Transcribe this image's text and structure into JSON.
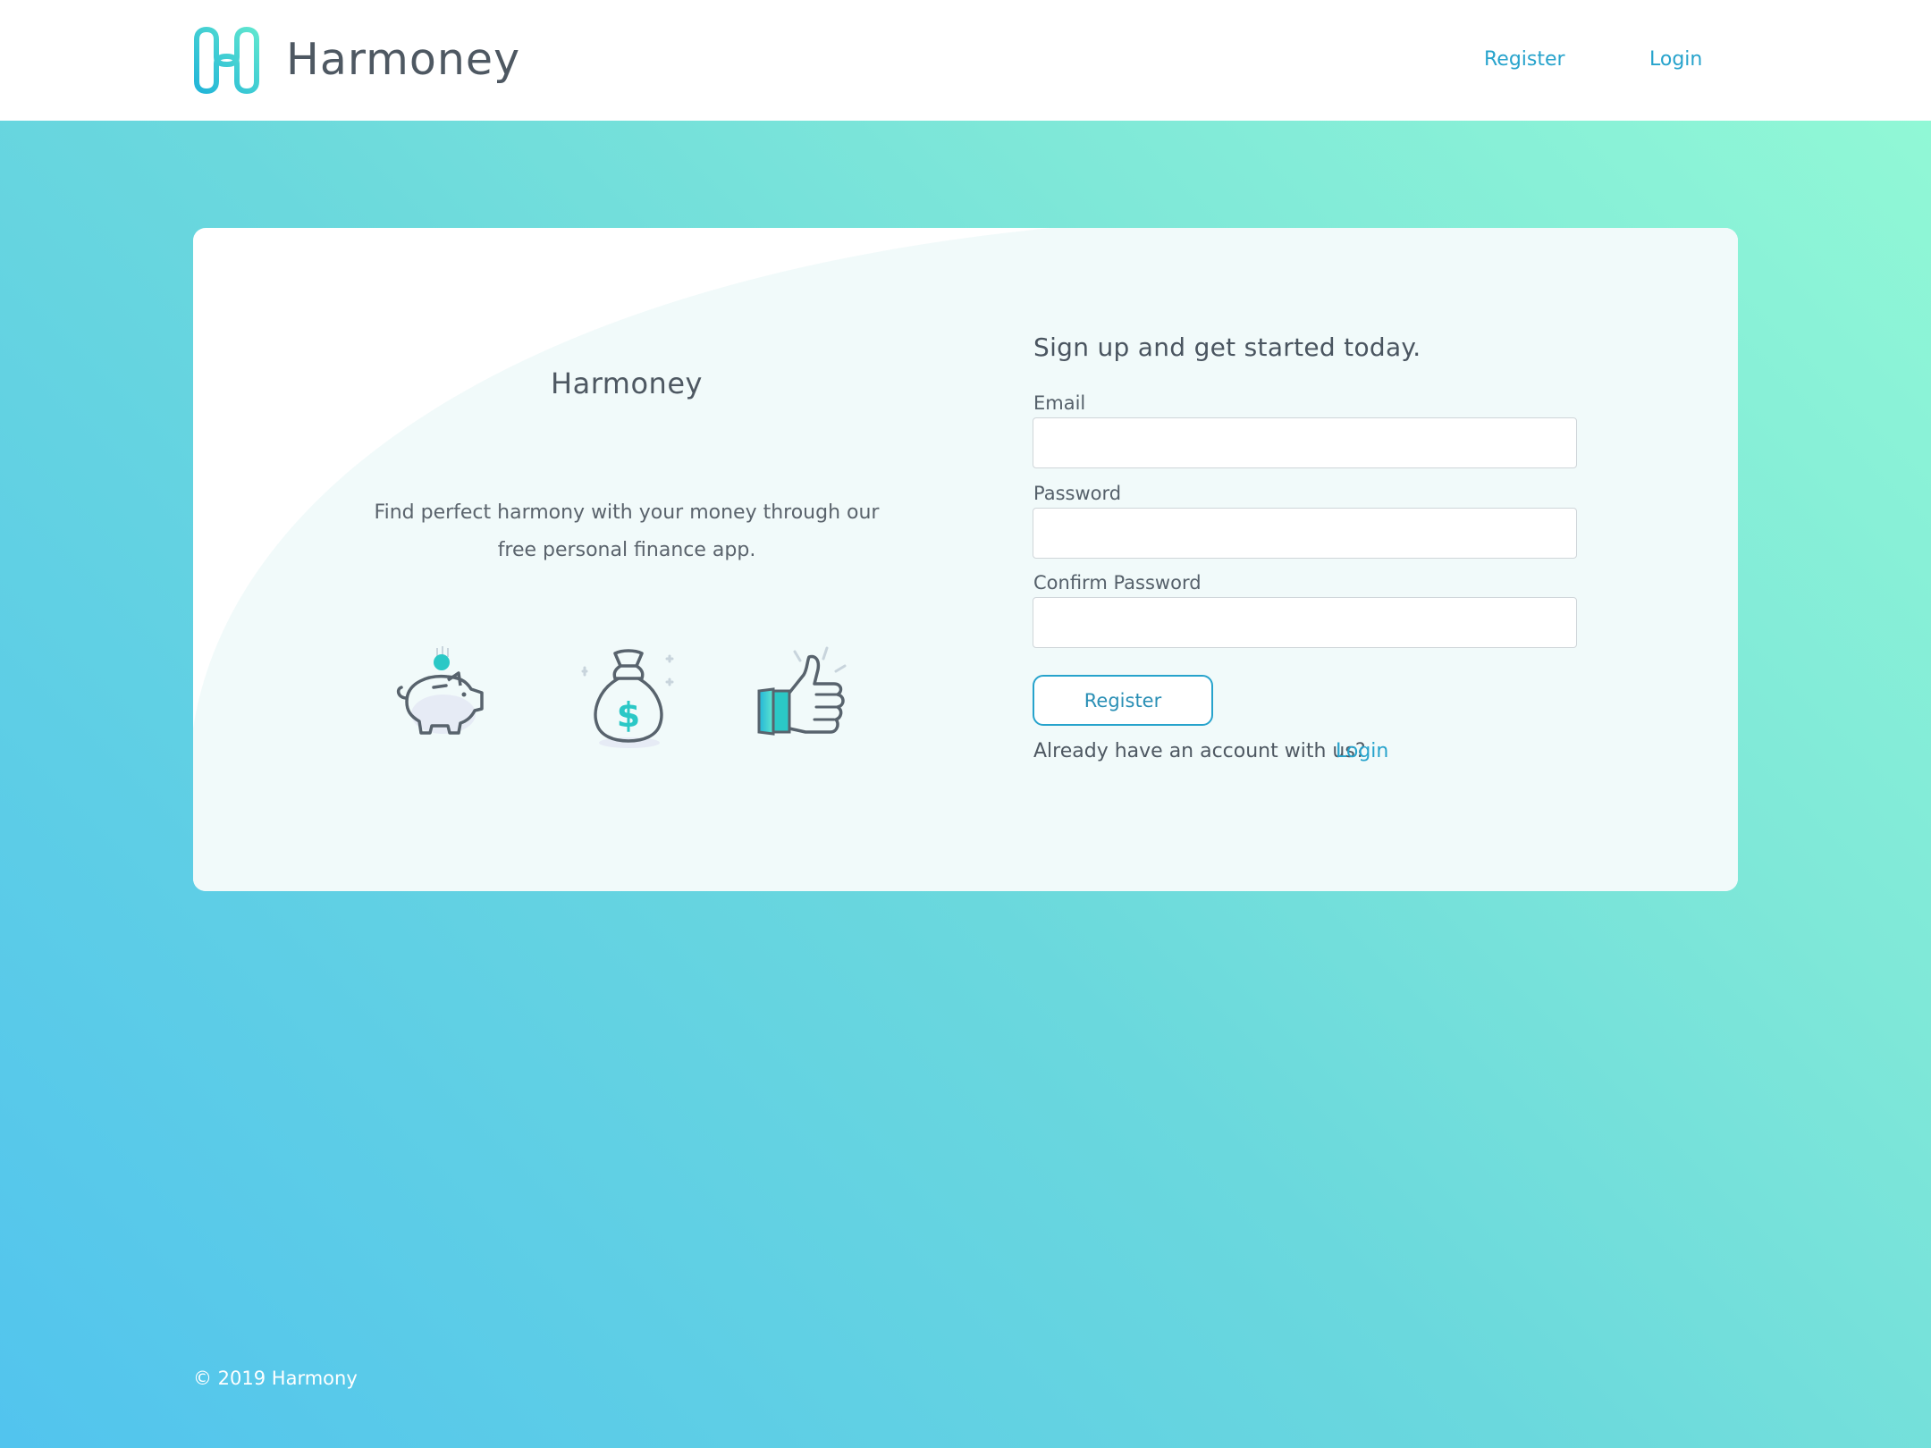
{
  "header": {
    "brand": "Harmoney",
    "nav": {
      "register": "Register",
      "login": "Login"
    }
  },
  "card": {
    "left": {
      "title": "Harmoney",
      "description": "Find perfect harmony with your money through our free personal finance app.",
      "icons": [
        "piggy-bank-icon",
        "money-bag-icon",
        "thumbs-up-icon"
      ]
    },
    "form": {
      "title": "Sign up and get started today.",
      "email_label": "Email",
      "email_value": "",
      "password_label": "Password",
      "password_value": "",
      "confirm_label": "Confirm Password",
      "confirm_value": "",
      "submit_label": "Register",
      "already_text": "Already have an account with us?",
      "login_link": "Login"
    }
  },
  "footer": {
    "copyright": "© 2019 Harmony"
  },
  "colors": {
    "accent": "#27a3cc",
    "teal": "#3dd6c8",
    "text": "#4e5862"
  }
}
